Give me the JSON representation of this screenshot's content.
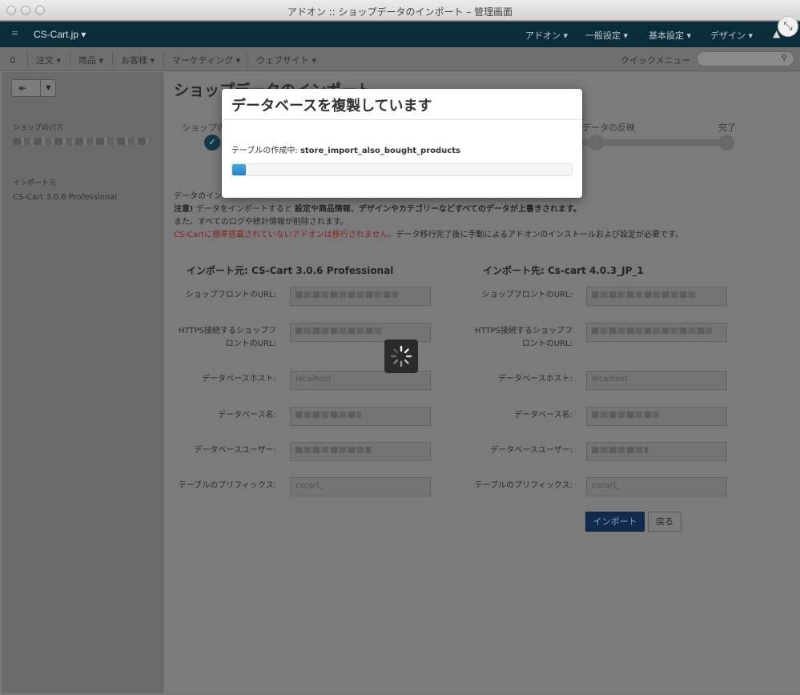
{
  "window": {
    "title": "アドオン :: ショップデータのインポート – 管理画面"
  },
  "topbar": {
    "brand": "CS-Cart.jp ▾",
    "items": [
      "アドオン ▾",
      "一般設定 ▾",
      "基本設定 ▾",
      "デザイン ▾"
    ]
  },
  "navbar": {
    "items": [
      "注文 ▾",
      "商品 ▾",
      "お客様 ▾",
      "マーケティング ▾",
      "ウェブサイト ▾"
    ],
    "quick_menu": "クイックメニュー"
  },
  "sidebar": {
    "shop_path_label": "ショップのパス",
    "source_label": "インポート元",
    "source_value": "CS-Cart 3.0.6 Professional"
  },
  "page": {
    "title": "ショップデータのインポート",
    "steps": {
      "first": "ショップの",
      "reflect": "データの反映",
      "done": "完了"
    },
    "info": {
      "line1": "データのイン",
      "line2_bold": "注意!",
      "line2_a": " データをインポートすると ",
      "line2_b": "設定や商品情報、デザインやカテゴリーなどすべてのデータが上書きされます。",
      "line3": "また、すべてのログや統計情報が削除されます。",
      "line4_warn": "CS-Cartに標準搭載されていないアドオンは移行されません。",
      "line4_rest": "データ移行完了後に手動によるアドオンのインストールおよび設定が必要です。"
    }
  },
  "source": {
    "title": "インポート元: CS-Cart 3.0.6 Professional",
    "db_host": "localhost",
    "prefix": "cscart_"
  },
  "target": {
    "title": "インポート先: Cs-cart 4.0.3_JP_1",
    "db_host": "localhost",
    "prefix": "cscart_"
  },
  "labels": {
    "storefront_url": "ショップフロントのURL:",
    "https_url_1": "HTTPS接続するショップフ",
    "https_url_2": "ロントのURL:",
    "db_host": "データベースホスト:",
    "db_name": "データベース名:",
    "db_user": "データベースユーザー:",
    "table_prefix": "テーブルのプリフィックス:"
  },
  "buttons": {
    "import": "インポート",
    "back": "戻る"
  },
  "modal": {
    "title": "データベースを複製しています",
    "status_prefix": "テーブルの作成中: ",
    "table_name": "store_import_also_bought_products",
    "progress": 0.04
  }
}
